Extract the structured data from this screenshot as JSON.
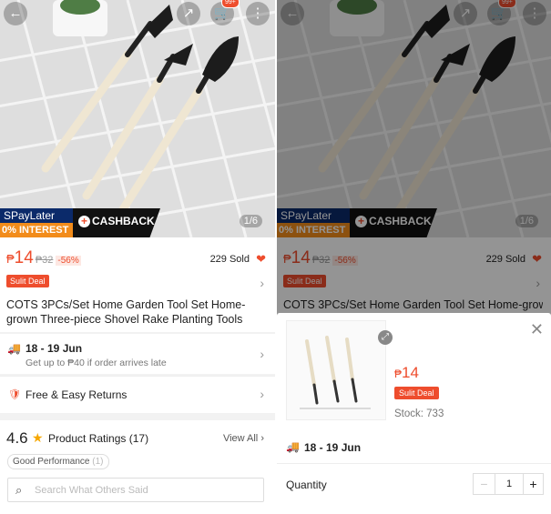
{
  "product": {
    "price_currency": "₱",
    "price": "14",
    "old_price": "₱32",
    "discount": "-56%",
    "sold": "229 Sold",
    "deal_badge": "Sulit Deal",
    "title": "COTS 3PCs/Set Home Garden Tool Set Home-grown Three-piece Shovel Rake Planting Tools",
    "title_truncated": "COTS 3PCs/Set Home Garden Tool Set Home-grown",
    "image_counter": "1/6"
  },
  "top_bar": {
    "cart_badge": "99+"
  },
  "promo": {
    "spaylater": "SPayLater",
    "interest": "0% INTEREST",
    "cashback": "CASHBACK"
  },
  "shipping": {
    "date": "18 - 19 Jun",
    "note": "Get up to ₱40 if order arrives late"
  },
  "returns": {
    "label": "Free & Easy Returns"
  },
  "ratings": {
    "score": "4.6",
    "label": "Product Ratings",
    "count": "(17)",
    "view_all": "View All",
    "tag_label": "Good Performance",
    "tag_count": "(1)"
  },
  "search": {
    "placeholder": "Search What Others Said"
  },
  "sheet": {
    "price_currency": "₱",
    "price": "14",
    "deal_badge": "Sulit Deal",
    "stock": "Stock: 733",
    "ship_date": "18 - 19 Jun",
    "quantity_label": "Quantity",
    "quantity": "1"
  },
  "icons": {
    "back": "back-arrow-icon",
    "share": "share-icon",
    "cart": "cart-icon",
    "more": "more-icon",
    "heart": "heart-icon",
    "star": "star-icon",
    "truck": "truck-icon",
    "shield": "shield-icon",
    "search": "search-icon",
    "close": "close-icon",
    "zoom": "zoom-icon"
  },
  "colors": {
    "accent": "#ee4d2d",
    "teal": "#26aa99",
    "star": "#f6a700"
  }
}
